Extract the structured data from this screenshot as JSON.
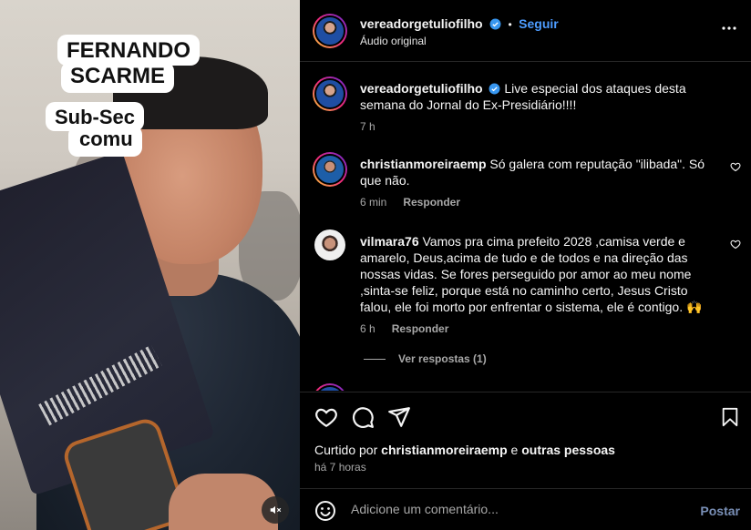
{
  "media": {
    "captions": [
      "FERNANDO",
      "SCARME",
      "Sub-Sec",
      "comu"
    ]
  },
  "post": {
    "author": "vereadorgetuliofilho",
    "follow_label": "Seguir",
    "separator": "•",
    "audio": "Áudio original",
    "caption": "Live especial dos ataques desta semana do Jornal do Ex-Presidiário!!!!",
    "caption_time": "7 h"
  },
  "comments": [
    {
      "username": "christianmoreiraemp",
      "text": "Só galera com reputação \"ilibada\". Só que não.",
      "time": "6 min",
      "reply_label": "Responder"
    },
    {
      "username": "vilmara76",
      "text": "Vamos pra cima prefeito 2028 ,camisa verde e amarelo, Deus,acima de tudo e de todos e na direção das nossas vidas. Se fores perseguido por amor ao meu nome ,sinta-se feliz, porque está no caminho certo, Jesus Cristo falou, ele foi morto por enfrentar o sistema, ele é contigo. 🙌",
      "time": "6 h",
      "reply_label": "Responder",
      "view_replies": "Ver respostas (1)"
    }
  ],
  "likes": {
    "prefix": "Curtido por",
    "user": "christianmoreiraemp",
    "conj": "e",
    "others": "outras pessoas"
  },
  "posted_time": "há 7 horas",
  "add_comment": {
    "placeholder": "Adicione um comentário...",
    "post_label": "Postar"
  },
  "colors": {
    "link": "#4d9cff",
    "verified": "#3897f0",
    "background": "#000000"
  }
}
